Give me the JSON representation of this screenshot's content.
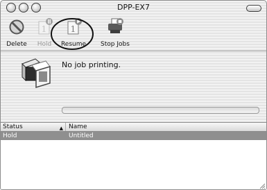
{
  "window": {
    "title": "DPP-EX7"
  },
  "toolbar": {
    "delete_label": "Delete",
    "hold_label": "Hold",
    "resume_label": "Resume",
    "stop_jobs_label": "Stop Jobs"
  },
  "status": {
    "message": "No job printing."
  },
  "jobs": {
    "columns": {
      "status": "Status",
      "name": "Name"
    },
    "sort_arrow": "▲",
    "rows": [
      {
        "status": "Hold",
        "name": "Untitled"
      }
    ]
  }
}
